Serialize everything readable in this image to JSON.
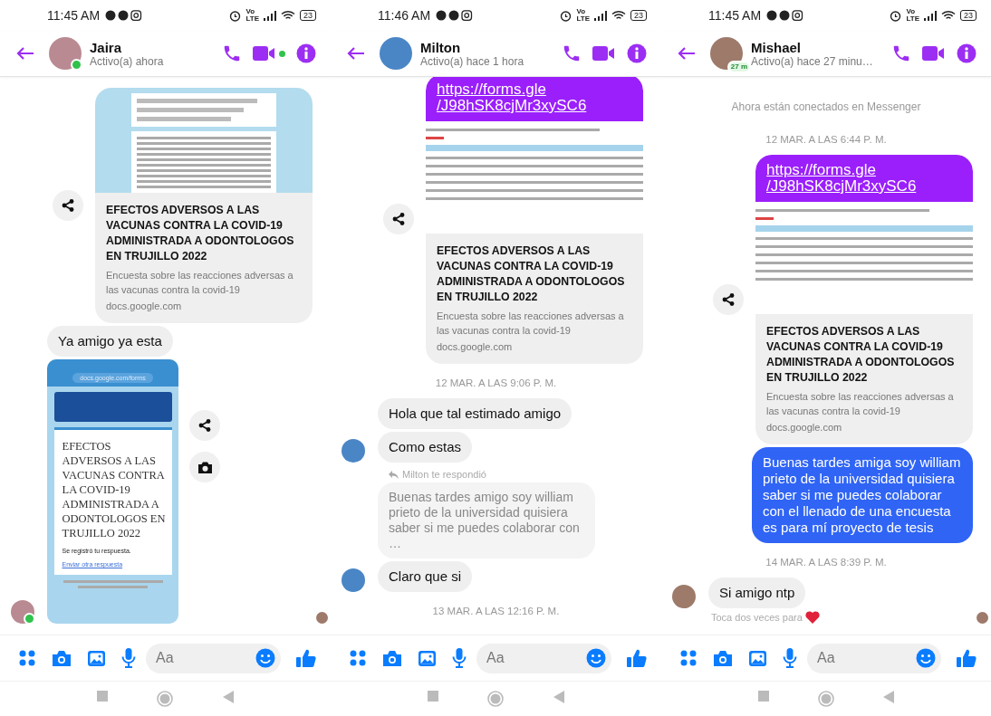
{
  "phones": [
    {
      "status_bar": {
        "time": "11:45 AM",
        "network": [
          "Vo",
          "LTE"
        ],
        "battery": "23"
      },
      "header": {
        "name": "Jaira",
        "status": "Activo(a) ahora",
        "online": true,
        "video_dot": true
      },
      "messages": [
        {
          "kind": "link_card",
          "preview": {
            "kind": "banner"
          },
          "title": "EFECTOS ADVERSOS A LAS VACUNAS CONTRA LA COVID-19 ADMINISTRADA A ODONTOLOGOS EN TRUJILLO 2022",
          "description": "Encuesta sobre las reacciones adversas a las vacunas contra la covid-19",
          "domain": "docs.google.com"
        },
        {
          "kind": "received_text",
          "text": "Ya amigo ya esta",
          "avatar": false
        },
        {
          "kind": "screenshot",
          "avatar": true,
          "url": "docs.google.com/forms",
          "title": "EFECTOS ADVERSOS A LAS VACUNAS CONTRA LA COVID-19 ADMINISTRADA A ODONTOLOGOS EN TRUJILLO 2022",
          "confirmation": "Se registró tu respuesta.",
          "link": "Enviar otra respuesta",
          "seen": true
        }
      ],
      "composer": {
        "placeholder": "Aa"
      }
    },
    {
      "status_bar": {
        "time": "11:46 AM",
        "network": [
          "Vo",
          "LTE"
        ],
        "battery": "23"
      },
      "header": {
        "name": "Milton",
        "status": "Activo(a) hace 1 hora",
        "online": false,
        "video_dot": false
      },
      "messages": [
        {
          "kind": "bubble_cut"
        },
        {
          "kind": "link_card",
          "url_lines": [
            "https://forms.gle",
            "/J98hSK8cjMr3xySC6"
          ],
          "preview": {
            "kind": "document"
          },
          "title": "EFECTOS ADVERSOS A LAS VACUNAS CONTRA LA COVID-19 ADMINISTRADA A ODONTOLOGOS EN TRUJILLO 2022",
          "description": "Encuesta sobre las reacciones adversas a las vacunas contra la covid-19",
          "domain": "docs.google.com"
        },
        {
          "kind": "timestamp",
          "text": "12 MAR. A LAS 9:06 P. M."
        },
        {
          "kind": "received_text",
          "text": "Hola que tal estimado amigo",
          "avatar": false
        },
        {
          "kind": "received_text",
          "text": "Como estas",
          "avatar": true
        },
        {
          "kind": "reply_label",
          "text": "Milton te respondió"
        },
        {
          "kind": "quote",
          "text": "Buenas tardes amigo soy william prieto de la universidad quisiera saber si me puedes colaborar con …"
        },
        {
          "kind": "received_text",
          "text": "Claro que si",
          "avatar": true
        },
        {
          "kind": "timestamp",
          "text": "13 MAR. A LAS 12:16 P. M."
        }
      ],
      "composer": {
        "placeholder": "Aa"
      }
    },
    {
      "status_bar": {
        "time": "11:45 AM",
        "network": [
          "Vo",
          "LTE"
        ],
        "battery": "23"
      },
      "header": {
        "name": "Mishael",
        "status": "Activo(a) hace 27 minu…",
        "online": false,
        "video_dot": false,
        "badge": "27 m"
      },
      "messages": [
        {
          "kind": "notice",
          "text": "Ahora están conectados en Messenger"
        },
        {
          "kind": "timestamp",
          "text": "12 MAR. A LAS 6:44 P. M."
        },
        {
          "kind": "link_card",
          "url_lines": [
            "https://forms.gle",
            "/J98hSK8cjMr3xySC6"
          ],
          "preview": {
            "kind": "document"
          },
          "title": "EFECTOS ADVERSOS A LAS VACUNAS CONTRA LA COVID-19 ADMINISTRADA A ODONTOLOGOS EN TRUJILLO 2022",
          "description": "Encuesta sobre las reacciones adversas a las vacunas contra la covid-19",
          "domain": "docs.google.com"
        },
        {
          "kind": "sent_text",
          "text": "Buenas tardes amiga soy william prieto de la universidad quisiera saber si me puedes colaborar con el llenado de una encuesta es para mí proyecto de tesis"
        },
        {
          "kind": "timestamp",
          "text": "14 MAR. A LAS 8:39 P. M."
        },
        {
          "kind": "received_text",
          "text": "Si amigo ntp",
          "avatar": true
        },
        {
          "kind": "hint",
          "text": "Toca dos veces para",
          "seen": true
        }
      ],
      "composer": {
        "placeholder": "Aa"
      }
    }
  ]
}
